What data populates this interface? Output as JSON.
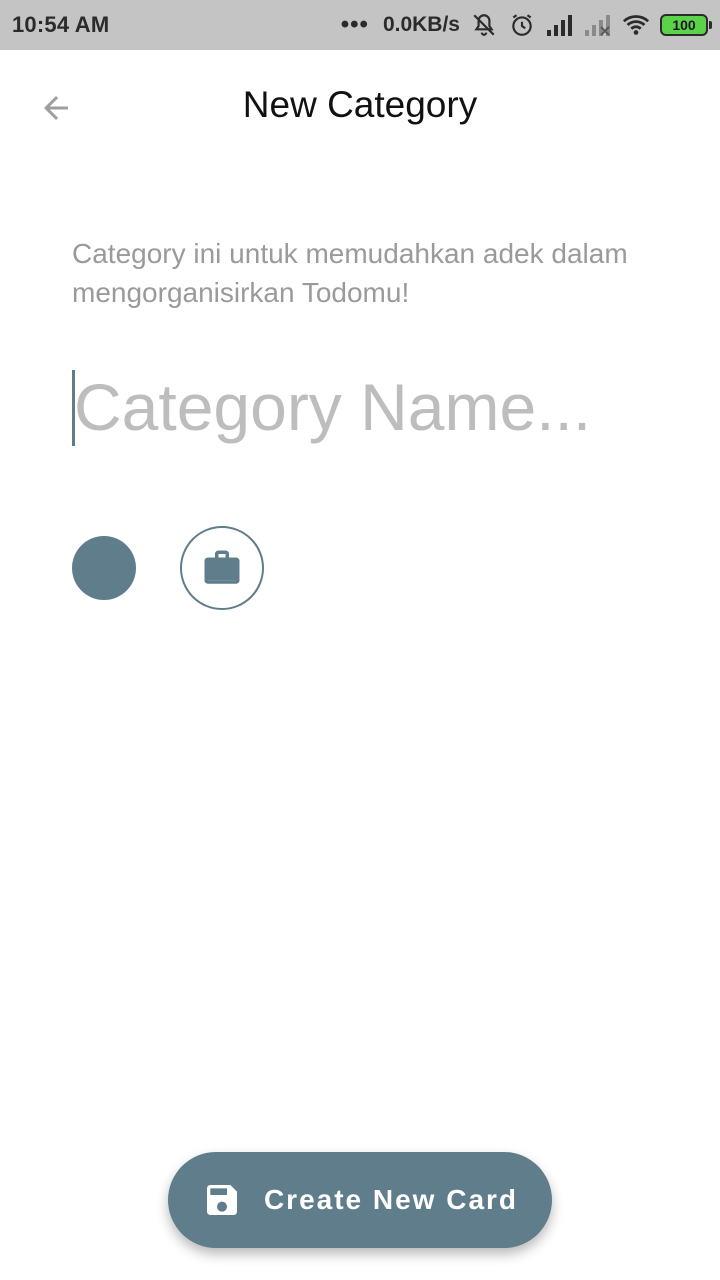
{
  "status_bar": {
    "time": "10:54 AM",
    "dots": "•••",
    "network_speed": "0.0KB/s",
    "battery": "100",
    "icons": [
      "dots-icon",
      "mute-icon",
      "alarm-icon",
      "signal-icon",
      "signal-off-icon",
      "wifi-icon",
      "battery-icon"
    ]
  },
  "app_bar": {
    "title": "New Category",
    "back_icon": "arrow-back-icon"
  },
  "content": {
    "description": "Category ini untuk memudahkan adek dalam mengorganisirkan Todomu!",
    "category_input": {
      "placeholder": "Category Name...",
      "value": ""
    },
    "selected_color": "#607d8b",
    "selected_icon": "briefcase-icon"
  },
  "fab": {
    "label": "Create New Card",
    "icon": "save-icon"
  },
  "colors": {
    "accent": "#607d8b",
    "status_bar_bg": "#c4c4c4",
    "text_secondary": "#9a9a9a",
    "placeholder": "#bdbdbd"
  }
}
